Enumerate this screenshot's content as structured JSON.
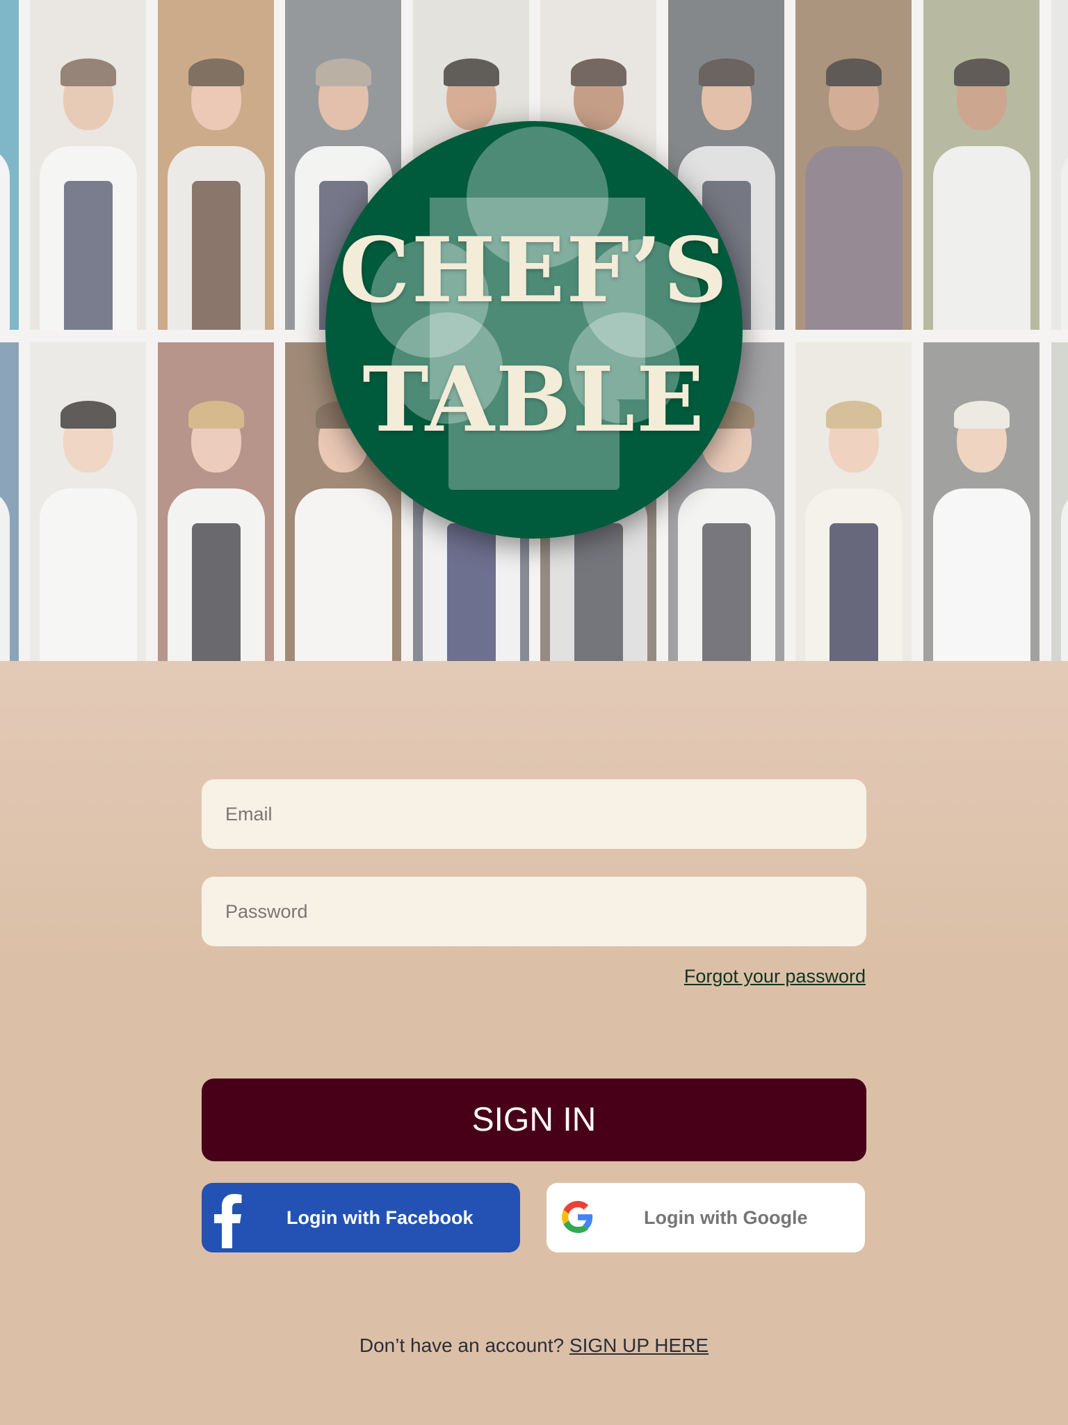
{
  "logo": {
    "line1": "CHEF’S",
    "line2": "TABLE",
    "circle_color": "#005a3c",
    "text_color": "#f3ecd9"
  },
  "hero": {
    "tiles": [
      {
        "bg": "#4a9ab5",
        "skin": "#e8c0a0",
        "hair": "#3a2a20",
        "body": "#f3f3f3",
        "apron": "#e9e9e9"
      },
      {
        "bg": "#e4e0db",
        "skin": "#e2b89a",
        "hair": "#6a5040",
        "body": "#f5f5f5",
        "apron": "#404660"
      },
      {
        "bg": "#b98a5c",
        "skin": "#e8b49a",
        "hair": "#4a3522",
        "body": "#e8e6e2",
        "apron": "#5a3d2e"
      },
      {
        "bg": "#6a6f74",
        "skin": "#d9a88c",
        "hair": "#a09080",
        "body": "#f2f2f2",
        "apron": "#3b3f58"
      },
      {
        "bg": "#dcd9d4",
        "skin": "#c98e6a",
        "hair": "#1e1814",
        "body": "#ececec",
        "apron": "#ececec"
      },
      {
        "bg": "#e3dfd8",
        "skin": "#b07656",
        "hair": "#3a2820",
        "body": "#efefef",
        "apron": "#efefef"
      },
      {
        "bg": "#50575a",
        "skin": "#d8a888",
        "hair": "#2c221c",
        "body": "#d8d8d8",
        "apron": "#3a3e4e"
      },
      {
        "bg": "#8a6a4a",
        "skin": "#c48c6c",
        "hair": "#1c1410",
        "body": "#6a5a6a",
        "apron": "#6a5a6a"
      },
      {
        "bg": "#9aa07a",
        "skin": "#b98260",
        "hair": "#1e1610",
        "body": "#ececea",
        "apron": "#ececea"
      },
      {
        "bg": "#e2e2e2",
        "skin": "#e0b49a",
        "hair": "#3a2a22",
        "body": "#eeeeee",
        "apron": "#eeeeee"
      },
      {
        "bg": "#5a7fa0",
        "skin": "#e4bea4",
        "hair": "#2a2018",
        "body": "#f0f0f0",
        "apron": "#f0f0f0"
      },
      {
        "bg": "#e6e4e2",
        "skin": "#ecc8b0",
        "hair": "#1a1614",
        "body": "#f6f6f6",
        "apron": "#f6f6f6"
      },
      {
        "bg": "#9a6a5a",
        "skin": "#e8bca4",
        "hair": "#c8a060",
        "body": "#f2f2f2",
        "apron": "#2a2a32"
      },
      {
        "bg": "#7a5a40",
        "skin": "#e4b498",
        "hair": "#5a4028",
        "body": "#f4f4f4",
        "apron": "#f4f4f4"
      },
      {
        "bg": "#545a6a",
        "skin": "#d4a082",
        "hair": "#2a2018",
        "body": "#f0f0f0",
        "apron": "#2e3460"
      },
      {
        "bg": "#6a5a50",
        "skin": "#dcae90",
        "hair": "#3a2a20",
        "body": "#d8d8da",
        "apron": "#3a3a46"
      },
      {
        "bg": "#7a7a80",
        "skin": "#e8bca0",
        "hair": "#7a5a3a",
        "body": "#f2f2f2",
        "apron": "#3e3e48"
      },
      {
        "bg": "#e8e4dc",
        "skin": "#ecc2a8",
        "hair": "#c8a870",
        "body": "#f4f0e8",
        "apron": "#262844"
      },
      {
        "bg": "#7a7a78",
        "skin": "#ecc4ac",
        "hair": "#e8e4dc",
        "body": "#f8f8f8",
        "apron": "#f8f8f8"
      },
      {
        "bg": "#c4c8c0",
        "skin": "#e0b498",
        "hair": "#3a2a20",
        "body": "#f0f0f0",
        "apron": "#f0f0f0"
      }
    ]
  },
  "form": {
    "email_placeholder": "Email",
    "password_placeholder": "Password",
    "forgot_label": "Forgot your password",
    "signin_label": "SIGN IN",
    "facebook_label": "Login with Facebook",
    "google_label": "Login with Google",
    "signup_prompt": "Don’t have an account?",
    "signup_link": "SIGN UP HERE"
  },
  "colors": {
    "page_bg": "#dbc0a7",
    "signin_bg": "#470018",
    "facebook_bg": "#2452b4",
    "google_bg": "#ffffff",
    "field_bg": "#f8f1e6"
  },
  "icons": {
    "facebook": "facebook-f-icon",
    "google": "google-g-icon",
    "logo_hat": "chef-hat-icon"
  }
}
